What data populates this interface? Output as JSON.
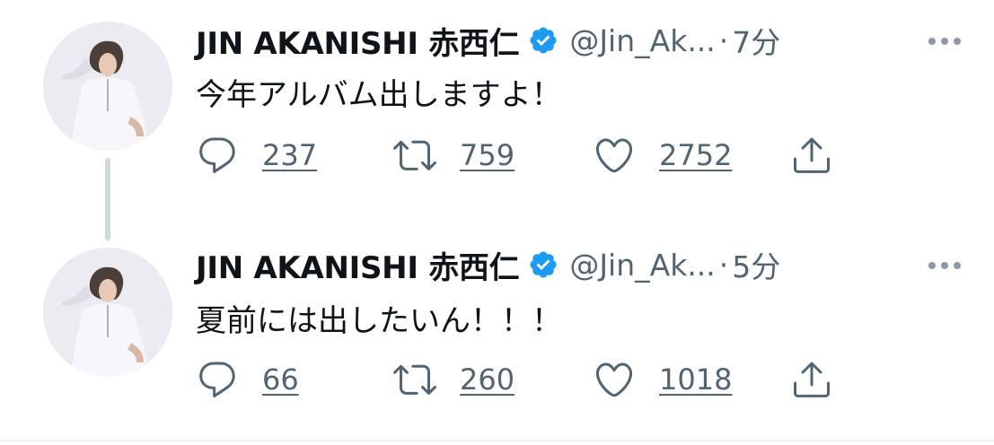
{
  "tweets": [
    {
      "name": "JIN AKANISHI 赤西仁",
      "handle": "@Jin_Ak...",
      "separator": "·",
      "time": "7分",
      "text": "今年アルバム出しますよ！",
      "replies": "237",
      "retweets": "759",
      "likes": "2752"
    },
    {
      "name": "JIN AKANISHI 赤西仁",
      "handle": "@Jin_Ak...",
      "separator": "·",
      "time": "5分",
      "text": "夏前には出したいん！！！",
      "replies": "66",
      "retweets": "260",
      "likes": "1018"
    }
  ],
  "colors": {
    "accent": "#1d9bf0",
    "muted": "#536471",
    "thread": "#cfd9de"
  },
  "icons": [
    "avatar",
    "verified-badge-icon",
    "more-icon",
    "reply-icon",
    "retweet-icon",
    "like-icon",
    "share-icon"
  ]
}
